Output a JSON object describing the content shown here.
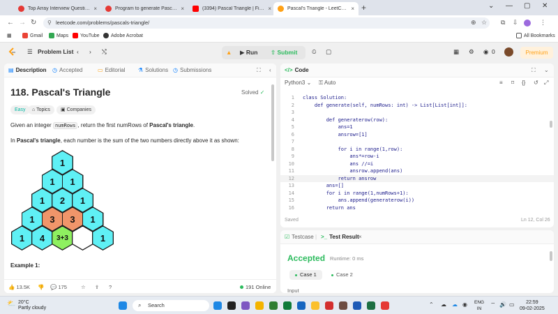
{
  "browser": {
    "tabs": [
      {
        "title": "Top Array Interview Questions",
        "color": "#e53935",
        "active": false
      },
      {
        "title": "Program to generate Pascal's Triangle",
        "color": "#e53935",
        "active": false
      },
      {
        "title": "(3394) Pascal Triangle | Finding...",
        "color": "#ff0000",
        "active": false
      },
      {
        "title": "Pascal's Triangle - LeetCode",
        "color": "#ffa116",
        "active": true
      }
    ],
    "close_glyph": "×",
    "new_tab_glyph": "+",
    "window_controls": [
      "⌄",
      "—",
      "▢",
      "✕"
    ],
    "url": "leetcode.com/problems/pascals-triangle/",
    "bookmarks": [
      {
        "label": "Gmail",
        "color": "#ea4335"
      },
      {
        "label": "Maps",
        "color": "#34a853"
      },
      {
        "label": "YouTube",
        "color": "#ff0000"
      },
      {
        "label": "Adobe Acrobat",
        "color": "#333333"
      }
    ],
    "all_bookmarks": "All Bookmarks"
  },
  "header": {
    "problem_list": "Problem List",
    "run": "Run",
    "submit": "Submit",
    "streak": "0",
    "premium": "Premium"
  },
  "description": {
    "tabs": [
      {
        "label": "Description",
        "icon": "▤"
      },
      {
        "label": "Accepted",
        "icon": "◷"
      },
      {
        "label": "Editorial",
        "icon": "▭"
      },
      {
        "label": "Solutions",
        "icon": "⚗"
      },
      {
        "label": "Submissions",
        "icon": "◷"
      }
    ],
    "title": "118. Pascal's Triangle",
    "status": "Solved",
    "difficulty": "Easy",
    "topics": "Topics",
    "companies": "Companies",
    "line1_a": "Given an integer ",
    "line1_code": "numRows",
    "line1_b": ", return the first numRows of ",
    "line1_bold": "Pascal's triangle",
    "line1_end": ".",
    "line2_a": "In ",
    "line2_bold": "Pascal's triangle",
    "line2_b": ", each number is the sum of the two numbers directly above it as shown:",
    "example_heading": "Example 1:",
    "likes": "13.5K",
    "comments": "175",
    "online": "191 Online"
  },
  "triangle": {
    "cyan": "#5ff0f5",
    "orange": "#f0956a",
    "green": "#8ef060",
    "white": "#ffffff",
    "rows": [
      [
        {
          "v": "1",
          "c": "cyan"
        }
      ],
      [
        {
          "v": "1",
          "c": "cyan"
        },
        {
          "v": "1",
          "c": "cyan"
        }
      ],
      [
        {
          "v": "1",
          "c": "cyan"
        },
        {
          "v": "2",
          "c": "cyan"
        },
        {
          "v": "1",
          "c": "cyan"
        }
      ],
      [
        {
          "v": "1",
          "c": "cyan"
        },
        {
          "v": "3",
          "c": "orange"
        },
        {
          "v": "3",
          "c": "orange"
        },
        {
          "v": "1",
          "c": "cyan"
        }
      ],
      [
        {
          "v": "1",
          "c": "cyan"
        },
        {
          "v": "4",
          "c": "cyan"
        },
        {
          "v": "3+3",
          "c": "green"
        },
        {
          "v": "",
          "c": "white"
        },
        {
          "v": "1",
          "c": "cyan"
        }
      ]
    ]
  },
  "code": {
    "title": "Code",
    "language": "Python3",
    "auto": "Auto",
    "lines": [
      "class Solution:",
      "    def generate(self, numRows: int) -> List[List[int]]:",
      "",
      "        def generaterow(row):",
      "            ans=1",
      "            ansrow=[1]",
      "",
      "            for i in range(1,row):",
      "                ans*=row-i",
      "                ans //=i",
      "                ansrow.append(ans)",
      "            return ansrow",
      "        ans=[]",
      "        for i in range(1,numRows+1):",
      "            ans.append(generaterow(i))",
      "        return ans"
    ],
    "current_line": 12,
    "saved": "Saved",
    "cursor": "Ln 12, Col 26"
  },
  "test": {
    "testcase_tab": "Testcase",
    "result_tab": "Test Result",
    "verdict": "Accepted",
    "runtime": "Runtime: 0 ms",
    "cases": [
      "Case 1",
      "Case 2"
    ],
    "input_label": "Input"
  },
  "taskbar": {
    "temp": "20°C",
    "weather": "Partly cloudy",
    "search": "Search",
    "lang_top": "ENG",
    "lang_bottom": "IN",
    "time": "22:59",
    "date": "09-02-2025",
    "apps": [
      "#1e88e5",
      "#222",
      "#7e57c2",
      "#f4b400",
      "#2e7d32",
      "#0f7b3a",
      "#1565c0",
      "#fbc02d",
      "#d32f2f",
      "#6d4c41",
      "#1e5ab6",
      "#1d6f42",
      "#e53935"
    ]
  }
}
